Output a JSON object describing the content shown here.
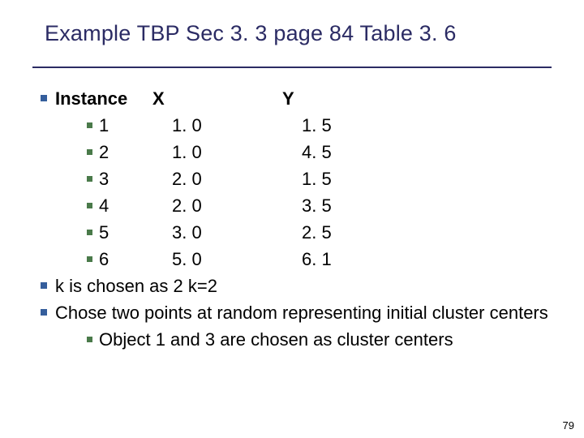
{
  "title": "Example TBP Sec 3. 3 page 84 Table 3. 6",
  "header": {
    "instance": "Instance",
    "x": "X",
    "y": "Y"
  },
  "rows": [
    {
      "i": "1",
      "x": "1. 0",
      "y": "1. 5"
    },
    {
      "i": "2",
      "x": "1. 0",
      "y": "4. 5"
    },
    {
      "i": "3",
      "x": "2. 0",
      "y": "1. 5"
    },
    {
      "i": "4",
      "x": "2. 0",
      "y": "3. 5"
    },
    {
      "i": "5",
      "x": "3. 0",
      "y": "2. 5"
    },
    {
      "i": "6",
      "x": "5. 0",
      "y": "6. 1"
    }
  ],
  "line_k": "k is chosen as 2 k=2",
  "line_choose": "Chose two points at random representing initial cluster centers",
  "line_objects": "Object 1 and 3 are chosen as cluster centers",
  "page_number": "79",
  "chart_data": {
    "type": "table",
    "title": "Example TBP Sec 3.3 page 84 Table 3.6",
    "columns": [
      "Instance",
      "X",
      "Y"
    ],
    "rows": [
      [
        1,
        1.0,
        1.5
      ],
      [
        2,
        1.0,
        4.5
      ],
      [
        3,
        2.0,
        1.5
      ],
      [
        4,
        2.0,
        3.5
      ],
      [
        5,
        3.0,
        2.5
      ],
      [
        6,
        5.0,
        6.1
      ]
    ],
    "annotations": [
      "k is chosen as 2 (k=2)",
      "Chose two points at random representing initial cluster centers",
      "Object 1 and 3 are chosen as cluster centers"
    ]
  }
}
